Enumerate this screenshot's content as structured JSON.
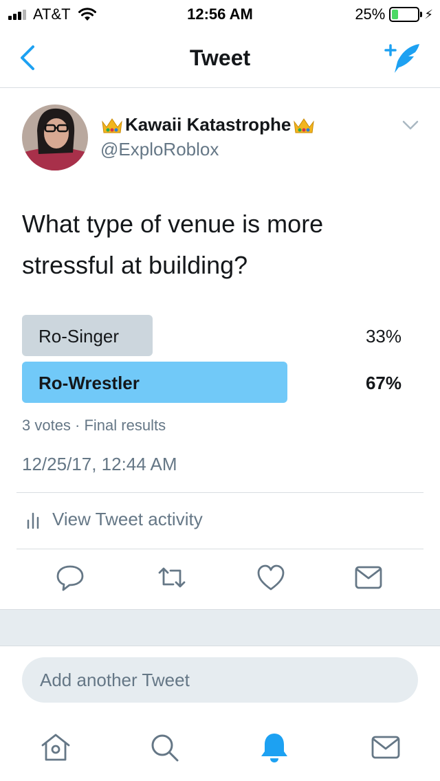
{
  "status_bar": {
    "carrier": "AT&T",
    "time": "12:56 AM",
    "battery_percent": "25%",
    "battery_level": 0.25,
    "signal_bars_filled": 3,
    "signal_bars_total": 4
  },
  "nav": {
    "title": "Tweet",
    "back_icon": "chevron-left-icon",
    "compose_icon": "compose-tweet-icon"
  },
  "tweet": {
    "display_name": "Kawaii Katastrophe",
    "handle": "@ExploRoblox",
    "text": "What type of venue is more stressful at building?",
    "timestamp": "12/25/17, 12:44 AM"
  },
  "poll": {
    "options": [
      {
        "label": "Ro-Singer",
        "percent": "33%",
        "fraction": 0.33,
        "winner": false
      },
      {
        "label": "Ro-Wrestler",
        "percent": "67%",
        "fraction": 0.67,
        "winner": true
      }
    ],
    "meta": "3 votes · Final results"
  },
  "activity": {
    "label": "View Tweet activity"
  },
  "actions": [
    "reply-icon",
    "retweet-icon",
    "like-icon",
    "direct-message-icon"
  ],
  "reply_box": {
    "placeholder": "Add another Tweet"
  },
  "tabbar": [
    "home-icon",
    "search-icon",
    "notifications-icon",
    "messages-icon"
  ],
  "colors": {
    "accent": "#1da1f2",
    "poll_winner": "#71c9f8",
    "poll_other": "#ccd6dd",
    "secondary_text": "#657786",
    "band": "#e6ecf0"
  }
}
